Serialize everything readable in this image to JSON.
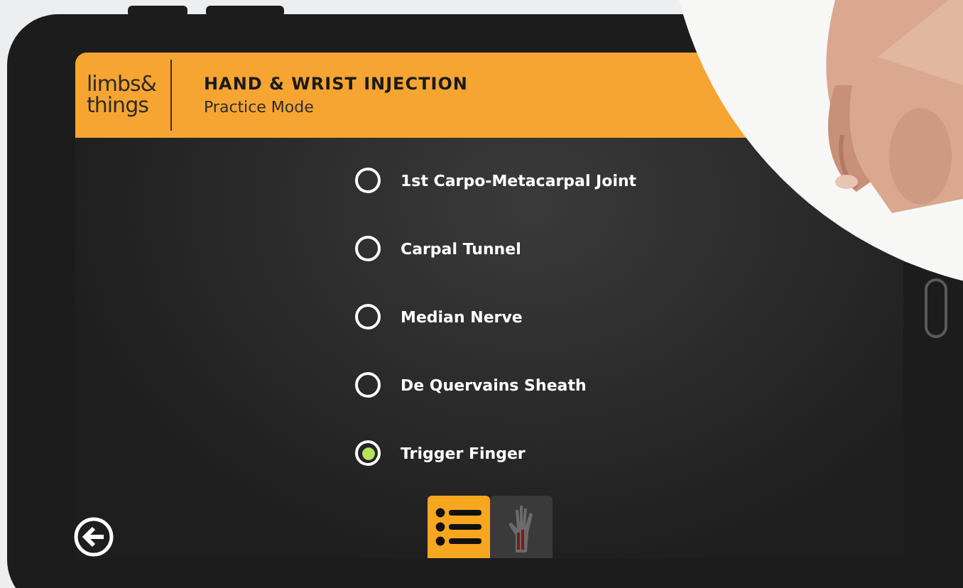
{
  "header": {
    "logo": [
      "limbs&",
      "things"
    ],
    "title": "HAND & WRIST INJECTION",
    "subtitle": "Practice Mode"
  },
  "options": [
    {
      "label": "1st Carpo-Metacarpal Joint",
      "selected": false
    },
    {
      "label": "Carpal Tunnel",
      "selected": false
    },
    {
      "label": "Median Nerve",
      "selected": false
    },
    {
      "label": "De Quervains Sheath",
      "selected": false
    },
    {
      "label": "Trigger Finger",
      "selected": true
    }
  ],
  "tabs": [
    {
      "kind": "list",
      "selected": true
    },
    {
      "kind": "hand",
      "selected": false
    }
  ]
}
